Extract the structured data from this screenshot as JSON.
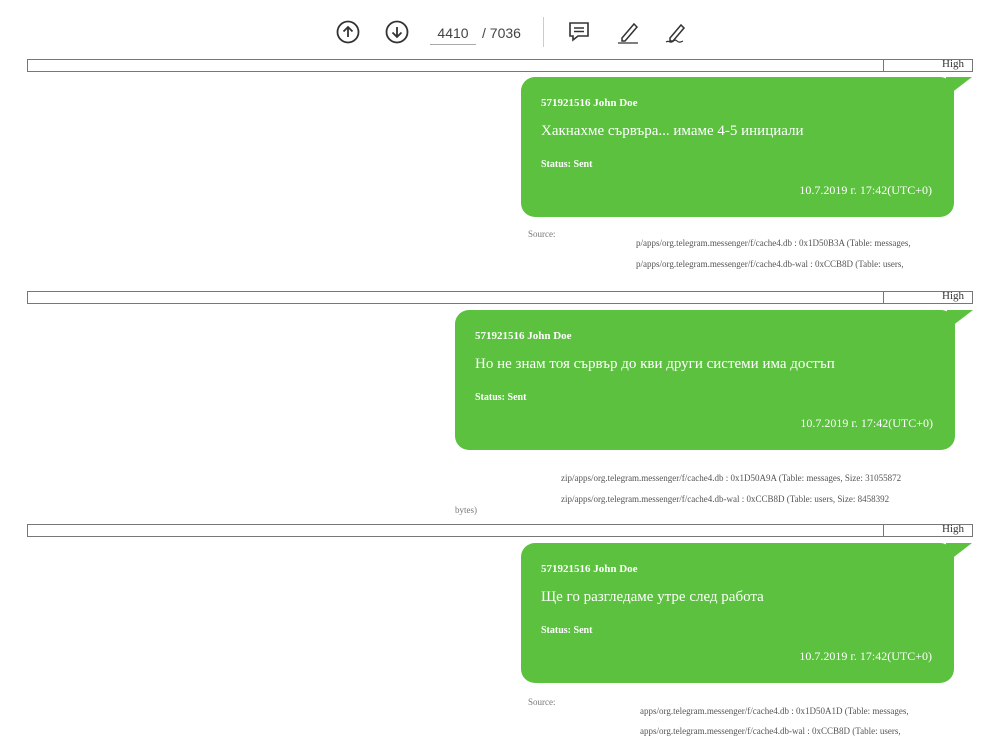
{
  "toolbar": {
    "page_current": "4410",
    "page_total": "/ 7036",
    "icons": [
      "arrow-up-circle",
      "arrow-down-circle",
      "comment",
      "highlighter-pen",
      "signature-pen"
    ]
  },
  "colors": {
    "bubble": "#5bc13f"
  },
  "records": [
    {
      "priority": "High",
      "sender": "571921516 John Doe",
      "message": "Хакнахме сървъра... имаме 4-5 инициали",
      "status_label": "Status:",
      "status_value": "Sent",
      "timestamp": "10.7.2019 г. 17:42(UTC+0)",
      "source_label": "Source:",
      "source_lines": [
        "p/apps/org.telegram.messenger/f/cache4.db : 0x1D50B3A (Table: messages,",
        "p/apps/org.telegram.messenger/f/cache4.db-wal : 0xCCB8D (Table: users,"
      ]
    },
    {
      "priority": "High",
      "sender": "571921516 John Doe",
      "message": "Но не знам тоя сървър до кви други системи има достъп",
      "status_label": "Status:",
      "status_value": "Sent",
      "timestamp": "10.7.2019 г. 17:42(UTC+0)",
      "source_label": "bytes)",
      "source_lines": [
        "zip/apps/org.telegram.messenger/f/cache4.db : 0x1D50A9A (Table: messages, Size: 31055872",
        "zip/apps/org.telegram.messenger/f/cache4.db-wal : 0xCCB8D (Table: users, Size: 8458392"
      ]
    },
    {
      "priority": "High",
      "sender": "571921516 John Doe",
      "message": "Ще го разгледаме утре след работа",
      "status_label": "Status:",
      "status_value": "Sent",
      "timestamp": "10.7.2019 г. 17:42(UTC+0)",
      "source_label": "Source:",
      "source_lines": [
        "apps/org.telegram.messenger/f/cache4.db : 0x1D50A1D (Table: messages,",
        "apps/org.telegram.messenger/f/cache4.db-wal : 0xCCB8D (Table: users,"
      ]
    }
  ]
}
